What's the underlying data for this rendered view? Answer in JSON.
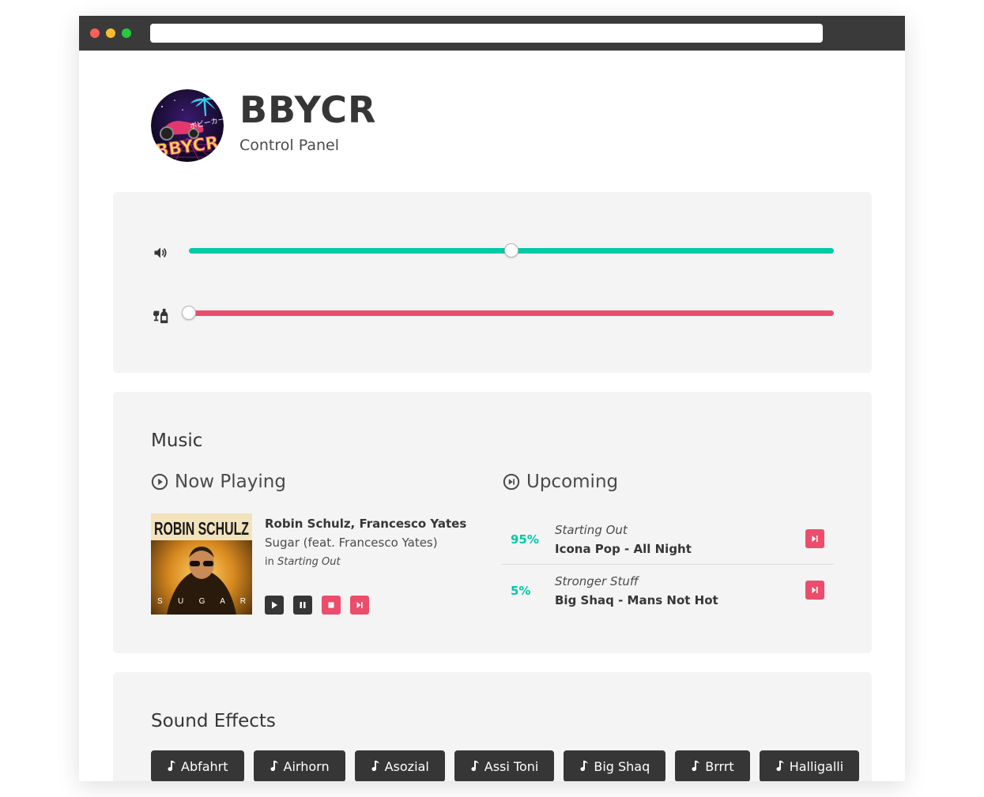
{
  "brand": {
    "title": "BBYCR",
    "subtitle": "Control Panel",
    "logo_text": "BBYCR",
    "logo_kana": "ボビーカー"
  },
  "sliders": {
    "volume": {
      "icon": "volume-icon",
      "value": 0.5,
      "color": "#00c9a7"
    },
    "drunk": {
      "icon": "bottle-glass-icon",
      "value": 0.0,
      "color": "#ec4d6c"
    }
  },
  "music": {
    "title": "Music",
    "now_playing": {
      "heading": "Now Playing",
      "artist": "Robin Schulz, Francesco Yates",
      "song": "Sugar (feat. Francesco Yates)",
      "in_label": "in",
      "playlist": "Starting Out",
      "album_text": "ROBIN SCHULZ",
      "album_letters": "S U G A R",
      "controls": [
        "play",
        "pause",
        "stop",
        "skip"
      ]
    },
    "upcoming": {
      "heading": "Upcoming",
      "items": [
        {
          "percent": "95%",
          "playlist": "Starting Out",
          "song": "Icona Pop - All Night"
        },
        {
          "percent": "5%",
          "playlist": "Stronger Stuff",
          "song": "Big Shaq - Mans Not Hot"
        }
      ]
    }
  },
  "sound_effects": {
    "title": "Sound Effects",
    "buttons": [
      "Abfahrt",
      "Airhorn",
      "Asozial",
      "Assi Toni",
      "Big Shaq",
      "Brrrt",
      "Halligalli"
    ]
  },
  "colors": {
    "accent": "#00c9a7",
    "danger": "#ec4d6c",
    "dark": "#363636",
    "panel": "#f4f4f4"
  }
}
